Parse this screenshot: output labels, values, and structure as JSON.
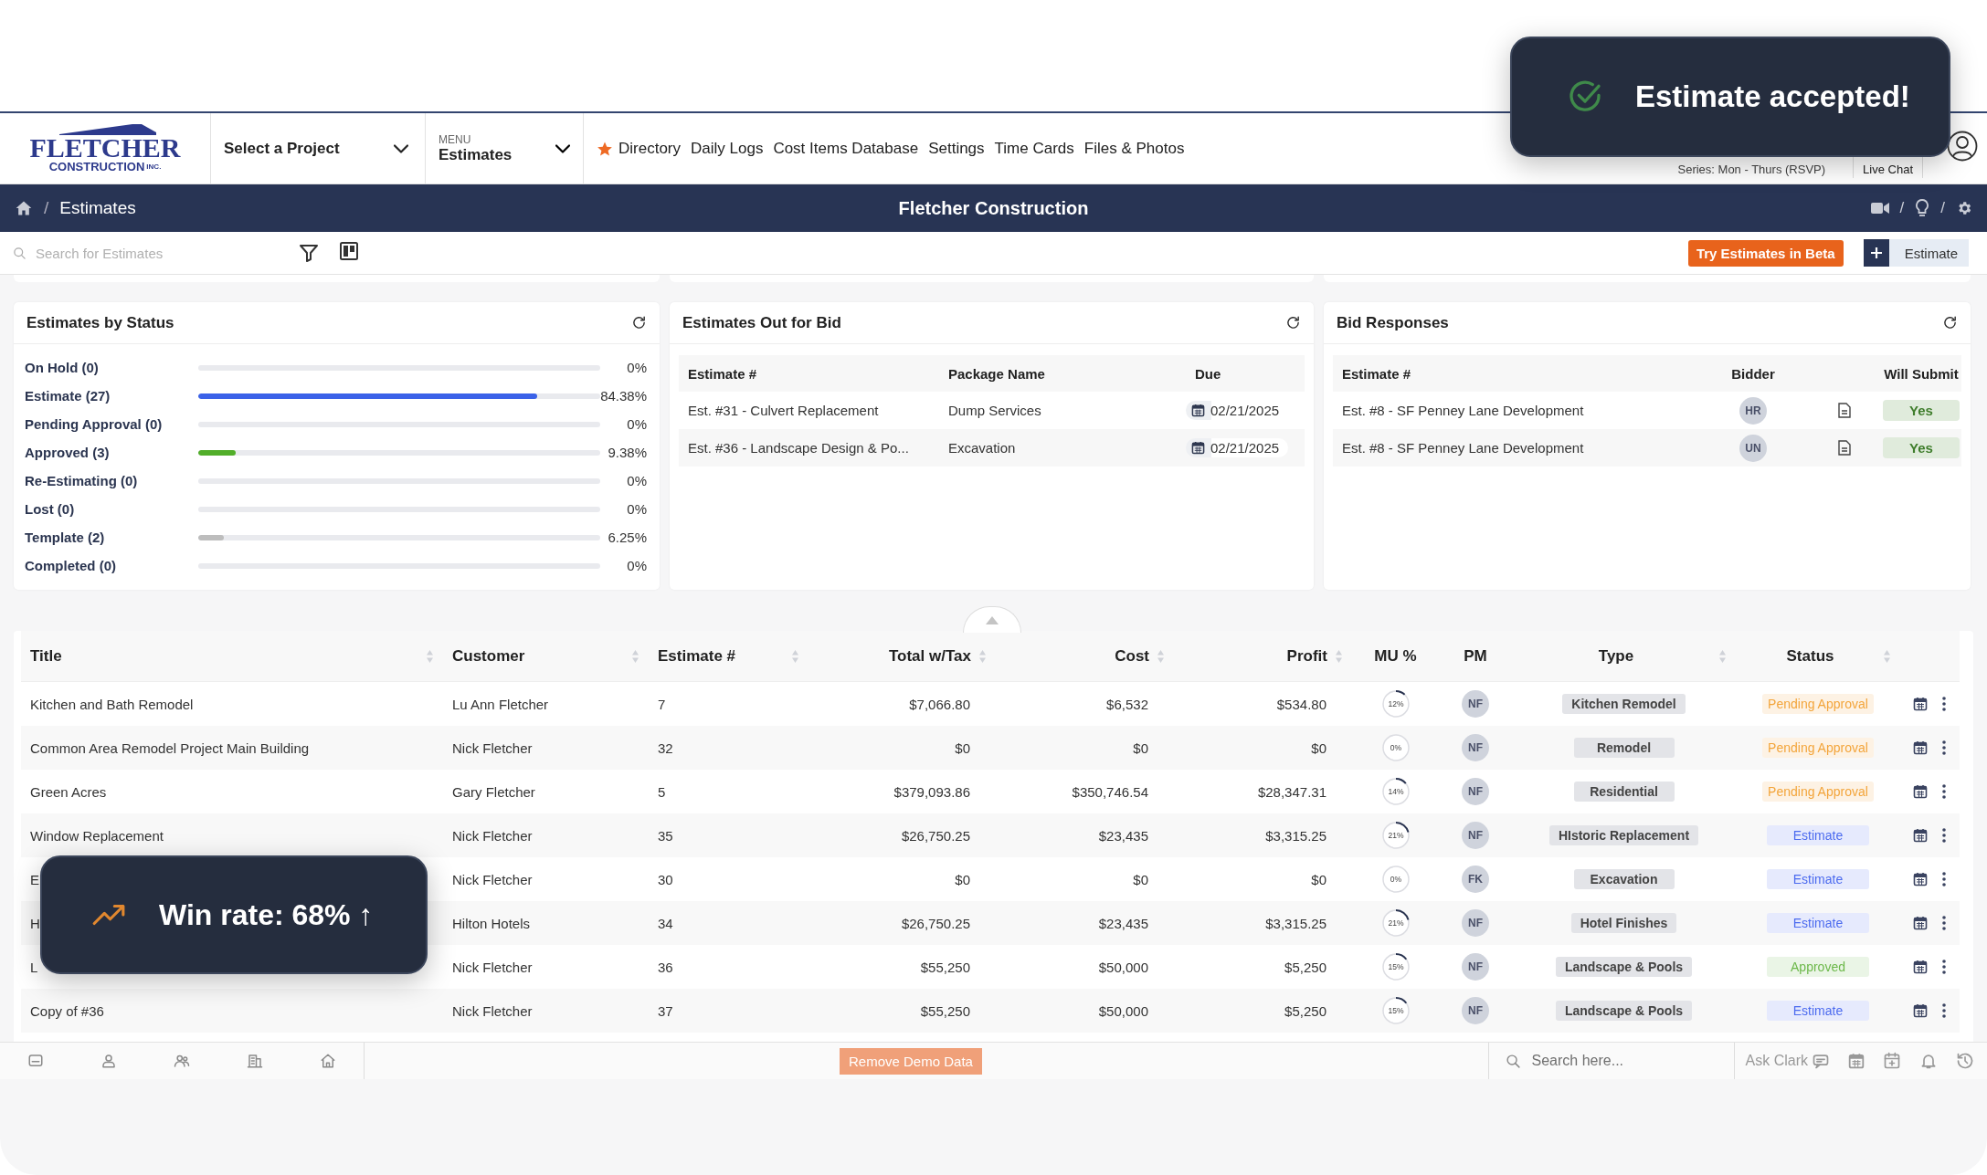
{
  "toast": {
    "message": "Estimate accepted!"
  },
  "logo": {
    "line1": "FLETCHER",
    "line2": "CONSTRUCTION",
    "suffix": "INC."
  },
  "header": {
    "project_select": "Select a Project",
    "menu_label": "MENU",
    "menu_value": "Estimates",
    "nav": [
      {
        "label": "Directory",
        "starred": true
      },
      {
        "label": "Daily Logs",
        "starred": false
      },
      {
        "label": "Cost Items Database",
        "starred": false
      },
      {
        "label": "Settings",
        "starred": false
      },
      {
        "label": "Time Cards",
        "starred": false
      },
      {
        "label": "Files & Photos",
        "starred": false
      }
    ],
    "series": "Series: Mon - Thurs (RSVP)",
    "live_chat": "Live Chat"
  },
  "title_bar": {
    "separator": "/",
    "current": "Estimates",
    "title": "Fletcher Construction",
    "icon_separators": [
      "/",
      "/"
    ]
  },
  "toolbar": {
    "search_placeholder": "Search for Estimates",
    "beta_button": "Try Estimates in Beta",
    "new_button": "Estimate"
  },
  "status_card": {
    "title": "Estimates by Status",
    "items": [
      {
        "label": "On Hold (0)",
        "level": 0,
        "percent": "0%"
      },
      {
        "label": "Estimate (27)",
        "level": 0.8438,
        "percent": "84.38%",
        "color": "#3b62e8"
      },
      {
        "label": "Pending Approval (0)",
        "level": 0,
        "percent": "0%"
      },
      {
        "label": "Approved (3)",
        "level": 0.0938,
        "percent": "9.38%",
        "color": "#52ae2a"
      },
      {
        "label": "Re-Estimating (0)",
        "level": 0,
        "percent": "0%"
      },
      {
        "label": "Lost (0)",
        "level": 0,
        "percent": "0%"
      },
      {
        "label": "Template (2)",
        "level": 0.0625,
        "percent": "6.25%",
        "color": "#bdbdbd"
      },
      {
        "label": "Completed (0)",
        "level": 0,
        "percent": "0%"
      }
    ]
  },
  "bid_card": {
    "title": "Estimates Out for Bid",
    "columns": [
      "Estimate #",
      "Package Name",
      "Due"
    ],
    "rows": [
      {
        "estimate": "Est. #31 - Culvert Replacement",
        "package": "Dump Services",
        "due": "02/21/2025"
      },
      {
        "estimate": "Est. #36 - Landscape Design & Po...",
        "package": "Excavation",
        "due": "02/21/2025"
      }
    ]
  },
  "responses_card": {
    "title": "Bid Responses",
    "columns": [
      "Estimate #",
      "Bidder",
      "Will Submit"
    ],
    "rows": [
      {
        "estimate": "Est. #8 - SF Penney Lane Development",
        "bidder": "HR",
        "will_submit": "Yes"
      },
      {
        "estimate": "Est. #8 - SF Penney Lane Development",
        "bidder": "UN",
        "will_submit": "Yes"
      }
    ]
  },
  "table": {
    "columns": [
      {
        "label": "Title",
        "sortable": true
      },
      {
        "label": "Customer",
        "sortable": true
      },
      {
        "label": "Estimate #",
        "sortable": true
      },
      {
        "label": "Total w/Tax",
        "sortable": true
      },
      {
        "label": "Cost",
        "sortable": true
      },
      {
        "label": "Profit",
        "sortable": true
      },
      {
        "label": "MU %",
        "sortable": false
      },
      {
        "label": "PM",
        "sortable": false
      },
      {
        "label": "Type",
        "sortable": true
      },
      {
        "label": "Status",
        "sortable": true
      }
    ],
    "rows": [
      {
        "title": "Kitchen and Bath Remodel",
        "customer": "Lu Ann Fletcher",
        "estimate": "7",
        "total": "$7,066.80",
        "cost": "$6,532",
        "profit": "$534.80",
        "mu": "12%",
        "pm": "NF",
        "type": "Kitchen Remodel",
        "status": "Pending Approval",
        "color": "#f3a53b"
      },
      {
        "title": "Common Area Remodel Project Main Building",
        "customer": "Nick Fletcher",
        "estimate": "32",
        "total": "$0",
        "cost": "$0",
        "profit": "$0",
        "mu": "0%",
        "pm": "NF",
        "type": "Remodel",
        "status": "Pending Approval",
        "color": "#f3a53b"
      },
      {
        "title": "Green Acres",
        "customer": "Gary Fletcher",
        "estimate": "5",
        "total": "$379,093.86",
        "cost": "$350,746.54",
        "profit": "$28,347.31",
        "mu": "14%",
        "pm": "NF",
        "type": "Residential",
        "status": "Pending Approval",
        "color": "#f3a53b"
      },
      {
        "title": "Window Replacement",
        "customer": "Nick Fletcher",
        "estimate": "35",
        "total": "$26,750.25",
        "cost": "$23,435",
        "profit": "$3,315.25",
        "mu": "21%",
        "pm": "NF",
        "type": "HIstoric Replacement",
        "status": "Estimate",
        "color": "#4c6bef"
      },
      {
        "title": "E",
        "customer": "Nick Fletcher",
        "estimate": "30",
        "total": "$0",
        "cost": "$0",
        "profit": "$0",
        "mu": "0%",
        "pm": "FK",
        "type": "Excavation",
        "status": "Estimate",
        "color": "#4c6bef"
      },
      {
        "title": "H",
        "customer": "Hilton Hotels",
        "estimate": "34",
        "total": "$26,750.25",
        "cost": "$23,435",
        "profit": "$3,315.25",
        "mu": "21%",
        "pm": "NF",
        "type": "Hotel Finishes",
        "status": "Estimate",
        "color": "#4c6bef"
      },
      {
        "title": "L",
        "customer": "Nick Fletcher",
        "estimate": "36",
        "total": "$55,250",
        "cost": "$50,000",
        "profit": "$5,250",
        "mu": "15%",
        "pm": "NF",
        "type": "Landscape & Pools",
        "status": "Approved",
        "color": "#6cb84a"
      },
      {
        "title": "Copy of #36",
        "customer": "Nick Fletcher",
        "estimate": "37",
        "total": "$55,250",
        "cost": "$50,000",
        "profit": "$5,250",
        "mu": "15%",
        "pm": "NF",
        "type": "Landscape & Pools",
        "status": "Estimate",
        "color": "#4c6bef"
      }
    ]
  },
  "bottom_bar": {
    "demo_button": "Remove Demo Data",
    "search_placeholder": "Search here...",
    "ask": "Ask Clark"
  },
  "win_toast": {
    "text": "Win rate: 68% ↑"
  }
}
